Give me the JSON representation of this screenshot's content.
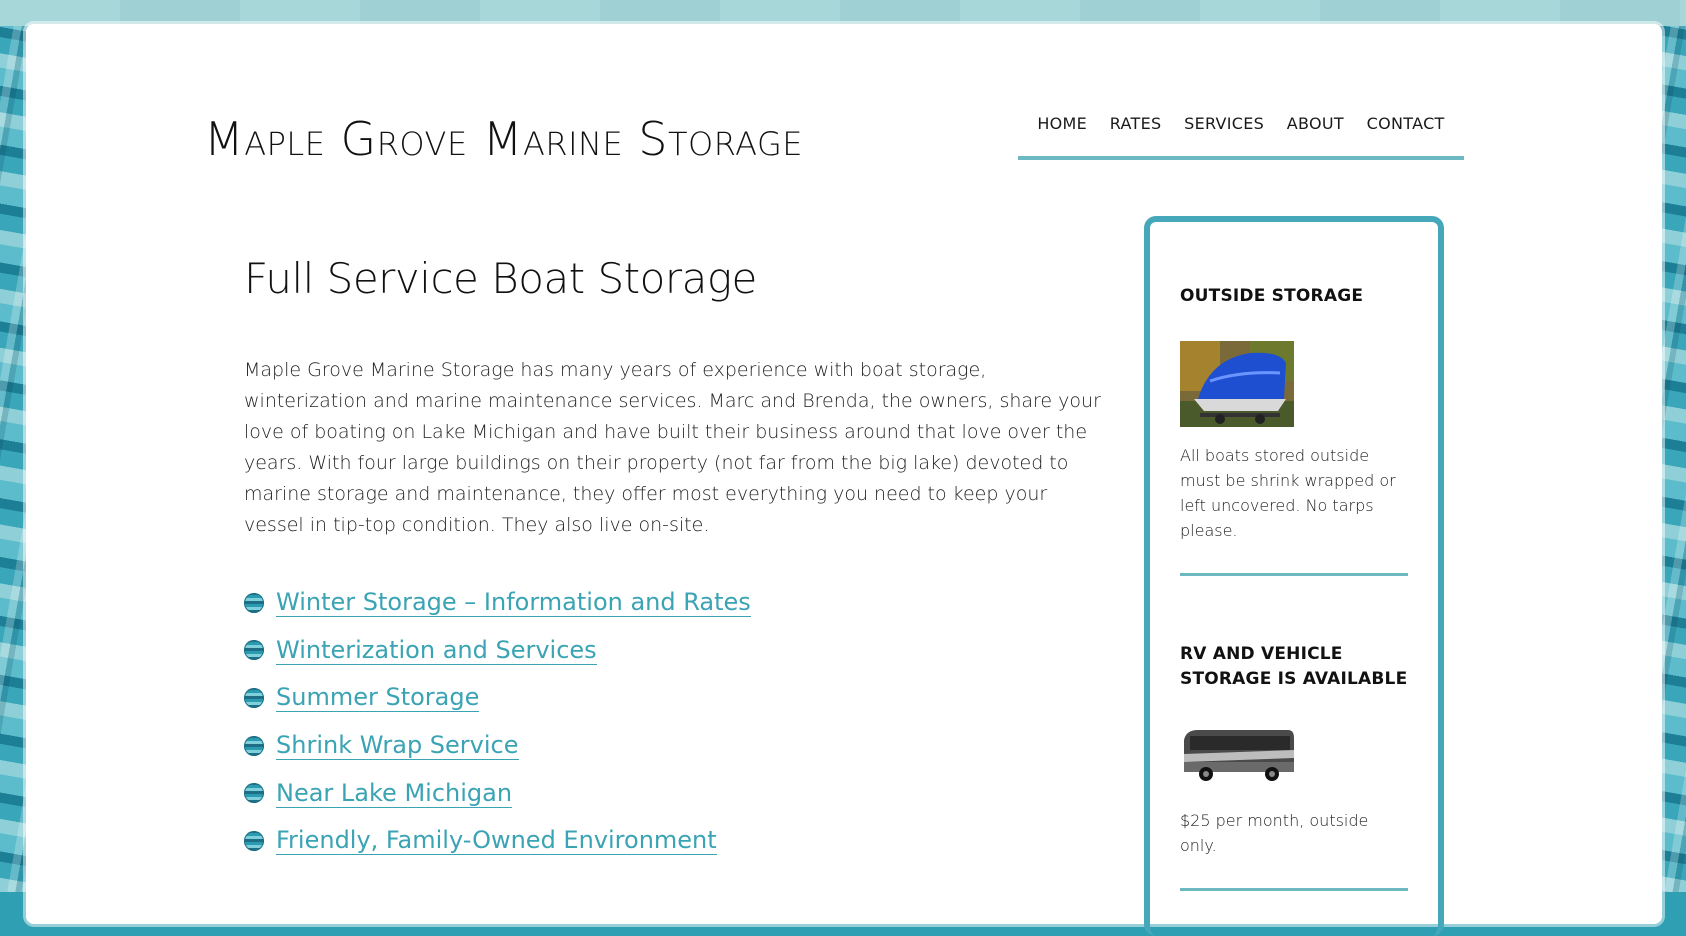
{
  "site": {
    "title": "Maple Grove Marine Storage"
  },
  "nav": {
    "items": [
      "HOME",
      "RATES",
      "SERVICES",
      "ABOUT",
      "CONTACT"
    ]
  },
  "main": {
    "heading": "Full Service Boat Storage",
    "intro": "Maple Grove Marine Storage has many years of experience with boat storage, winterization and marine maintenance services. Marc and Brenda, the owners, share your love of boating on Lake Michigan and have built their business around that love over the years. With four large buildings on their property (not far from the big lake) devoted to marine storage and maintenance, they offer most everything you need to keep your vessel in tip-top condition. They also live on-site.",
    "links": [
      "Winter Storage – Information and Rates",
      "Winterization and Services",
      "Summer Storage",
      "Shrink Wrap Service",
      "Near Lake Michigan",
      "Friendly, Family-Owned Environment"
    ]
  },
  "sidebar": {
    "widgets": [
      {
        "title": "OUTSIDE STORAGE",
        "text": "All boats stored outside must be shrink wrapped or left uncovered. No tarps please."
      },
      {
        "title": "RV AND VEHICLE STORAGE IS AVAILABLE",
        "text": "$25 per month, outside only."
      }
    ]
  },
  "colors": {
    "accent": "#45a8ba",
    "link": "#3aa3b4",
    "rule": "#6cb9c2"
  }
}
